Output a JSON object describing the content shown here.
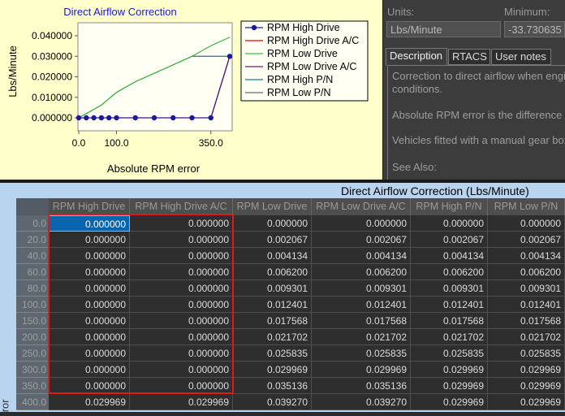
{
  "chart": {
    "title": "Direct Airflow Correction",
    "xlabel": "Absolute RPM error",
    "ylabel": "Lbs/Minute",
    "x_ticks": [
      "0.0",
      "100.0",
      "350.0"
    ],
    "y_ticks": [
      "0.000000",
      "0.010000",
      "0.020000",
      "0.030000",
      "0.040000"
    ]
  },
  "chart_data": {
    "type": "line",
    "title": "Direct Airflow Correction",
    "xlabel": "Absolute RPM error",
    "ylabel": "Lbs/Minute",
    "x": [
      0,
      20,
      40,
      60,
      80,
      100,
      150,
      200,
      250,
      300,
      350,
      400
    ],
    "xlim": [
      0,
      400
    ],
    "ylim": [
      0,
      0.04
    ],
    "grid": false,
    "legend_position": "right",
    "series": [
      {
        "name": "RPM High Drive",
        "color": "#1a1a9c",
        "values": [
          0,
          0,
          0,
          0,
          0,
          0,
          0,
          0,
          0,
          0,
          0,
          0.029969
        ]
      },
      {
        "name": "RPM High Drive A/C",
        "color": "#e00000",
        "values": [
          0,
          0,
          0,
          0,
          0,
          0,
          0,
          0,
          0,
          0,
          0,
          0.029969
        ]
      },
      {
        "name": "RPM Low Drive",
        "color": "#2bcc2b",
        "values": [
          0,
          0.002067,
          0.004134,
          0.0062,
          0.009301,
          0.012401,
          0.017568,
          0.021702,
          0.025835,
          0.029969,
          0.035136,
          0.03927
        ]
      },
      {
        "name": "RPM Low Drive A/C",
        "color": "#7a1a7a",
        "values": [
          0,
          0.002067,
          0.004134,
          0.0062,
          0.009301,
          0.012401,
          0.017568,
          0.021702,
          0.025835,
          0.029969,
          0.035136,
          0.03927
        ]
      },
      {
        "name": "RPM High P/N",
        "color": "#0e7d7d",
        "values": [
          0,
          0.002067,
          0.004134,
          0.0062,
          0.009301,
          0.012401,
          0.017568,
          0.021702,
          0.025835,
          0.029969,
          0.029969,
          0.029969
        ]
      },
      {
        "name": "RPM Low P/N",
        "color": "#6b6b6b",
        "values": [
          0,
          0.002067,
          0.004134,
          0.0062,
          0.009301,
          0.012401,
          0.017568,
          0.021702,
          0.025835,
          0.029969,
          0.029969,
          0.029969
        ]
      }
    ]
  },
  "right_panel": {
    "units_label": "Units:",
    "minimum_label": "Minimum:",
    "units_value": "Lbs/Minute",
    "minimum_value": "-33.730635",
    "tabs": [
      "Description",
      "RTACS",
      "User notes"
    ],
    "description": [
      "Correction to direct airflow when engin",
      "conditions.",
      "Absolute RPM error is the difference b",
      "Vehicles fitted with a manual gear box",
      "See Also:"
    ]
  },
  "table": {
    "title": "Direct Airflow Correction (Lbs/Minute)",
    "side_label": "rror",
    "columns": [
      "RPM High Drive",
      "RPM High Drive A/C",
      "RPM Low Drive",
      "RPM Low Drive A/C",
      "RPM High P/N",
      "RPM Low P/N"
    ],
    "rows": [
      {
        "label": "0.0",
        "cells": [
          "0.000000",
          "0.000000",
          "0.000000",
          "0.000000",
          "0.000000",
          "0.000000"
        ]
      },
      {
        "label": "20.0",
        "cells": [
          "0.000000",
          "0.000000",
          "0.002067",
          "0.002067",
          "0.002067",
          "0.002067"
        ]
      },
      {
        "label": "40.0",
        "cells": [
          "0.000000",
          "0.000000",
          "0.004134",
          "0.004134",
          "0.004134",
          "0.004134"
        ]
      },
      {
        "label": "60.0",
        "cells": [
          "0.000000",
          "0.000000",
          "0.006200",
          "0.006200",
          "0.006200",
          "0.006200"
        ]
      },
      {
        "label": "80.0",
        "cells": [
          "0.000000",
          "0.000000",
          "0.009301",
          "0.009301",
          "0.009301",
          "0.009301"
        ]
      },
      {
        "label": "100.0",
        "cells": [
          "0.000000",
          "0.000000",
          "0.012401",
          "0.012401",
          "0.012401",
          "0.012401"
        ]
      },
      {
        "label": "150.0",
        "cells": [
          "0.000000",
          "0.000000",
          "0.017568",
          "0.017568",
          "0.017568",
          "0.017568"
        ]
      },
      {
        "label": "200.0",
        "cells": [
          "0.000000",
          "0.000000",
          "0.021702",
          "0.021702",
          "0.021702",
          "0.021702"
        ]
      },
      {
        "label": "250.0",
        "cells": [
          "0.000000",
          "0.000000",
          "0.025835",
          "0.025835",
          "0.025835",
          "0.025835"
        ]
      },
      {
        "label": "300.0",
        "cells": [
          "0.000000",
          "0.000000",
          "0.029969",
          "0.029969",
          "0.029969",
          "0.029969"
        ]
      },
      {
        "label": "350.0",
        "cells": [
          "0.000000",
          "0.000000",
          "0.035136",
          "0.035136",
          "0.029969",
          "0.029969"
        ]
      },
      {
        "label": "400.0",
        "cells": [
          "0.029969",
          "0.029969",
          "0.039270",
          "0.039270",
          "0.029969",
          "0.029969"
        ]
      }
    ]
  }
}
